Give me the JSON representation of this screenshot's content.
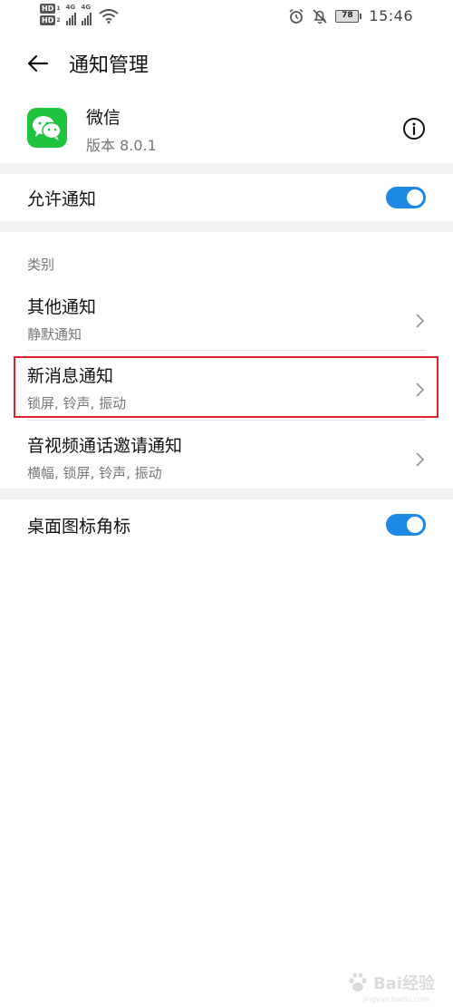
{
  "status_bar": {
    "hd1": "HD",
    "hd1_sub": "1",
    "hd2": "HD",
    "hd2_sub": "2",
    "signal1_label": "4G",
    "signal2_label": "4G",
    "battery": "78",
    "time": "15:46",
    "icons": [
      "alarm-icon",
      "mute-notification-icon",
      "wifi-icon"
    ]
  },
  "header": {
    "title": "通知管理"
  },
  "app": {
    "name": "微信",
    "version": "版本 8.0.1",
    "icon_color": "#1fc33e"
  },
  "allow_notifications": {
    "label": "允许通知",
    "enabled": true
  },
  "category_section": {
    "label": "类别",
    "items": [
      {
        "title": "其他通知",
        "subtitle": "静默通知"
      },
      {
        "title": "新消息通知",
        "subtitle": "锁屏, 铃声, 振动"
      },
      {
        "title": "音视频通话邀请通知",
        "subtitle": "横幅, 锁屏, 铃声, 振动"
      }
    ]
  },
  "badge_setting": {
    "label": "桌面图标角标",
    "enabled": true
  },
  "colors": {
    "switch_on": "#1e88e5",
    "highlight": "#d9232d"
  },
  "watermark": {
    "text": "Bai经验",
    "sub": "jingyan.baidu.com"
  }
}
